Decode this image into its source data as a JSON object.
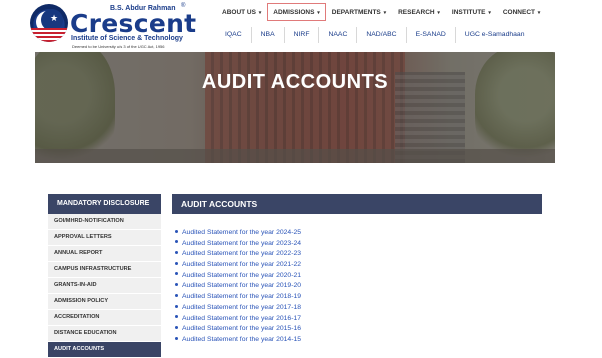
{
  "logo": {
    "top_text": "B.S. Abdur Rahman",
    "reg_mark": "®",
    "main_text": "Crescent",
    "sub_text": "Institute of Science & Technology",
    "deemed_text": "Deemed to be University u/s 3 of the UGC Act, 1956"
  },
  "nav": {
    "items": [
      {
        "label": "ABOUT US"
      },
      {
        "label": "ADMISSIONS"
      },
      {
        "label": "DEPARTMENTS"
      },
      {
        "label": "RESEARCH"
      },
      {
        "label": "INSTITUTE"
      },
      {
        "label": "CONNECT"
      }
    ],
    "caret": "▾"
  },
  "subnav": {
    "items": [
      {
        "label": "IQAC"
      },
      {
        "label": "NBA"
      },
      {
        "label": "NIRF"
      },
      {
        "label": "NAAC"
      },
      {
        "label": "NAD/ABC"
      },
      {
        "label": "E-SANAD"
      },
      {
        "label": "UGC e-Samadhaan"
      }
    ]
  },
  "banner": {
    "title": "AUDIT ACCOUNTS"
  },
  "sidebar": {
    "heading": "MANDATORY DISCLOSURE",
    "items": [
      {
        "label": "GOI/MHRD-NOTIFICATION"
      },
      {
        "label": "APPROVAL LETTERS"
      },
      {
        "label": "ANNUAL REPORT"
      },
      {
        "label": "CAMPUS INFRASTRUCTURE"
      },
      {
        "label": "GRANTS-IN-AID"
      },
      {
        "label": "ADMISSION POLICY"
      },
      {
        "label": "ACCREDITATION"
      },
      {
        "label": "DISTANCE EDUCATION"
      },
      {
        "label": "AUDIT ACCOUNTS"
      }
    ]
  },
  "main": {
    "heading": "AUDIT ACCOUNTS",
    "links": [
      {
        "label": "Audited Statement for the year 2024-25"
      },
      {
        "label": "Audited Statement for the year 2023-24"
      },
      {
        "label": "Audited Statement for the year 2022-23"
      },
      {
        "label": "Audited Statement for the year 2021-22"
      },
      {
        "label": "Audited Statement for the year 2020-21"
      },
      {
        "label": "Audited Statement for the year 2019-20"
      },
      {
        "label": "Audited Statement for the year 2018-19"
      },
      {
        "label": "Audited Statement for the year 2017-18"
      },
      {
        "label": "Audited Statement for the year 2016-17"
      },
      {
        "label": "Audited Statement for the year 2015-16"
      },
      {
        "label": "Audited Statement for the year 2014-15"
      }
    ]
  },
  "colors": {
    "brand_navy": "#1a3c8a",
    "panel_header": "#3a4566",
    "link_blue": "#2a54b8",
    "active_nav_border": "#e07a7a"
  }
}
